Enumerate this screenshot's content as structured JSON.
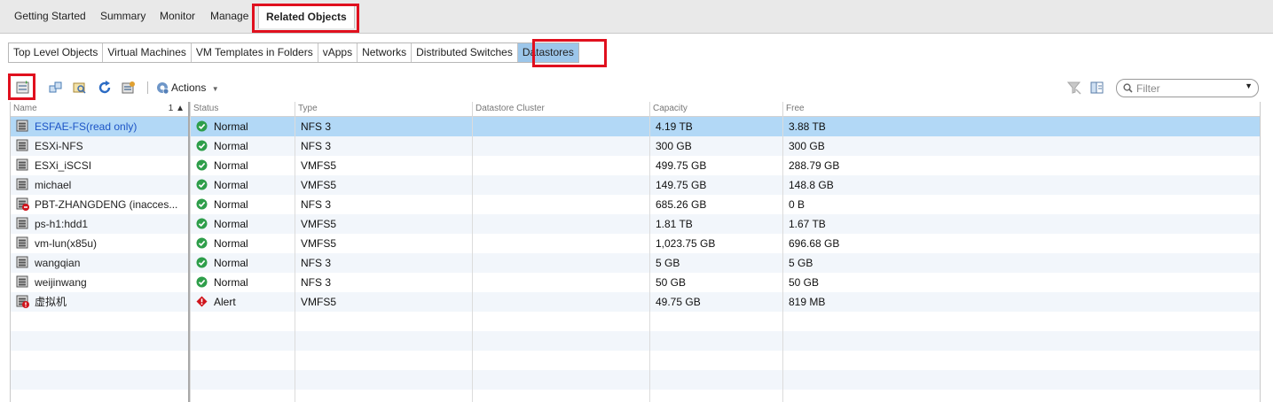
{
  "top_tabs": [
    {
      "label": "Getting Started"
    },
    {
      "label": "Summary"
    },
    {
      "label": "Monitor"
    },
    {
      "label": "Manage"
    },
    {
      "label": "Related Objects",
      "active": true
    }
  ],
  "sub_tabs": [
    {
      "label": "Top Level Objects"
    },
    {
      "label": "Virtual Machines"
    },
    {
      "label": "VM Templates in Folders"
    },
    {
      "label": "vApps"
    },
    {
      "label": "Networks"
    },
    {
      "label": "Distributed Switches"
    },
    {
      "label": "Datastores",
      "active": true
    }
  ],
  "toolbar": {
    "actions_label": "Actions",
    "filter_placeholder": "Filter"
  },
  "table": {
    "columns": {
      "name": "Name",
      "sort_indicator": "1 ▲",
      "status": "Status",
      "type": "Type",
      "cluster": "Datastore Cluster",
      "capacity": "Capacity",
      "free": "Free"
    },
    "rows": [
      {
        "name": "ESFAE-FS(read only)",
        "status": "Normal",
        "type": "NFS 3",
        "cluster": "",
        "capacity": "4.19  TB",
        "free": "3.88  TB",
        "selected": true,
        "icon": "datastore-icon",
        "status_icon": "normal-icon"
      },
      {
        "name": "ESXi-NFS",
        "status": "Normal",
        "type": "NFS 3",
        "cluster": "",
        "capacity": "300  GB",
        "free": "300  GB",
        "icon": "datastore-icon",
        "status_icon": "normal-icon"
      },
      {
        "name": "ESXi_iSCSI",
        "status": "Normal",
        "type": "VMFS5",
        "cluster": "",
        "capacity": "499.75  GB",
        "free": "288.79  GB",
        "icon": "datastore-icon",
        "status_icon": "normal-icon"
      },
      {
        "name": "michael",
        "status": "Normal",
        "type": "VMFS5",
        "cluster": "",
        "capacity": "149.75  GB",
        "free": "148.8  GB",
        "icon": "datastore-icon",
        "status_icon": "normal-icon"
      },
      {
        "name": "PBT-ZHANGDENG (inacces...",
        "status": "Normal",
        "type": "NFS 3",
        "cluster": "",
        "capacity": "685.26  GB",
        "free": "0  B",
        "icon": "datastore-inaccessible-icon",
        "status_icon": "normal-icon"
      },
      {
        "name": "ps-h1:hdd1",
        "status": "Normal",
        "type": "VMFS5",
        "cluster": "",
        "capacity": "1.81  TB",
        "free": "1.67  TB",
        "icon": "datastore-icon",
        "status_icon": "normal-icon"
      },
      {
        "name": "vm-lun(x85u)",
        "status": "Normal",
        "type": "VMFS5",
        "cluster": "",
        "capacity": "1,023.75  GB",
        "free": "696.68  GB",
        "icon": "datastore-icon",
        "status_icon": "normal-icon"
      },
      {
        "name": "wangqian",
        "status": "Normal",
        "type": "NFS 3",
        "cluster": "",
        "capacity": "5  GB",
        "free": "5  GB",
        "icon": "datastore-icon",
        "status_icon": "normal-icon"
      },
      {
        "name": "weijinwang",
        "status": "Normal",
        "type": "NFS 3",
        "cluster": "",
        "capacity": "50  GB",
        "free": "50  GB",
        "icon": "datastore-icon",
        "status_icon": "normal-icon"
      },
      {
        "name": "虚拟机",
        "status": "Alert",
        "type": "VMFS5",
        "cluster": "",
        "capacity": "49.75  GB",
        "free": "819  MB",
        "icon": "datastore-alert-icon",
        "status_icon": "alert-icon"
      }
    ]
  },
  "colors": {
    "highlight_box": "#e0101e",
    "selected_row": "#b2d8f6",
    "active_subtab": "#9cc6ea",
    "normal_status": "#2e9e4a",
    "alert_status": "#d0141c"
  }
}
